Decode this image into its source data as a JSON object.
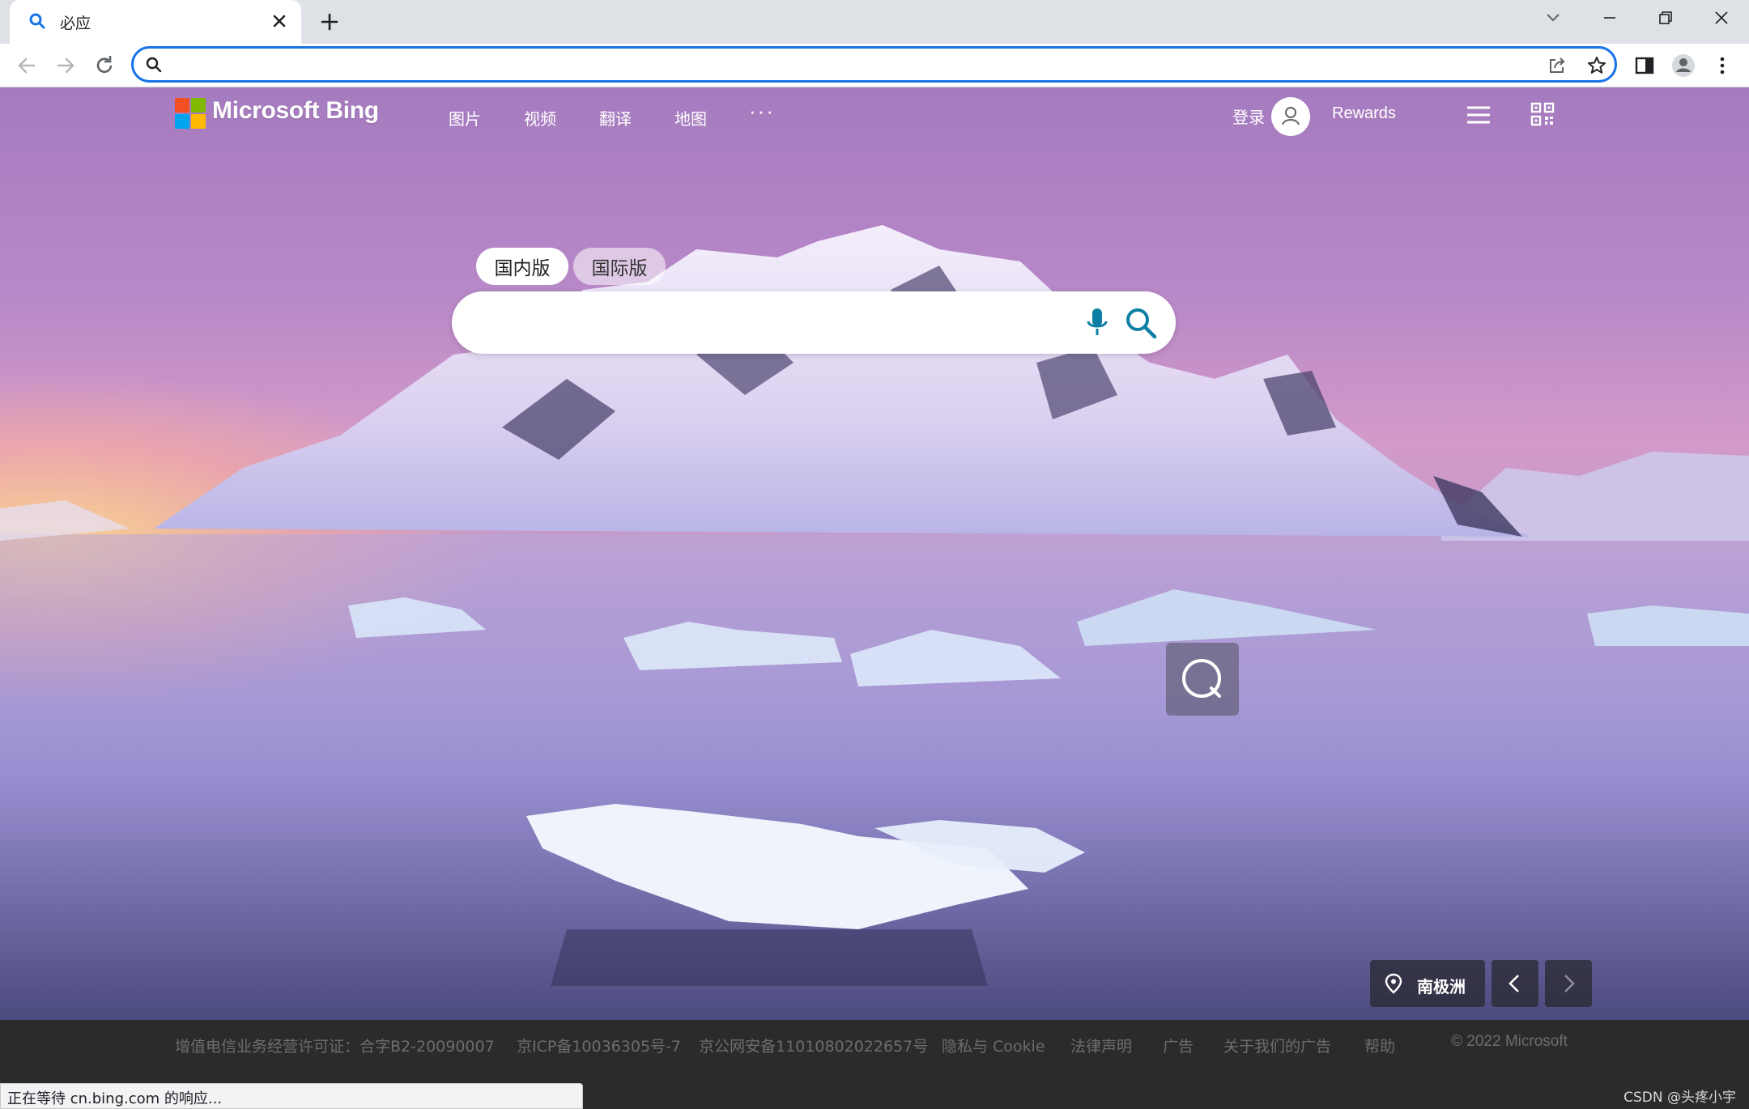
{
  "browser": {
    "tab_title": "必应",
    "address_value": "",
    "status_text": "正在等待 cn.bing.com 的响应..."
  },
  "header": {
    "brand": "Microsoft Bing",
    "nav": [
      "图片",
      "视频",
      "翻译",
      "地图"
    ],
    "more": "···",
    "login": "登录",
    "rewards": "Rewards"
  },
  "search": {
    "scope_tabs": [
      "国内版",
      "国际版"
    ],
    "active_scope": "国内版",
    "placeholder": ""
  },
  "image_info": {
    "location": "南极洲"
  },
  "footer": {
    "links": [
      "增值电信业务经营许可证：合字B2-20090007",
      "京ICP备10036305号-7",
      "京公网安备11010802022657号",
      "隐私与 Cookie",
      "法律声明",
      "广告",
      "关于我们的广告",
      "帮助"
    ],
    "copyright": "© 2022 Microsoft"
  },
  "watermark": "CSDN @头疼小宇",
  "colors": {
    "omnibox_focus": "#1a73e8",
    "search_icon": "#0c7fa4",
    "footer_bg": "#2b2b2b"
  }
}
